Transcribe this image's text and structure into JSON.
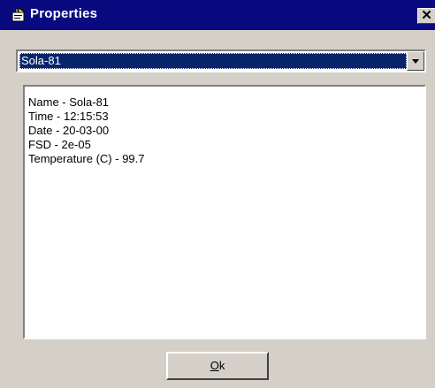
{
  "window": {
    "title": "Properties",
    "close_label": "✕",
    "icons": {
      "title": "properties-icon",
      "close": "close-icon",
      "dropdown": "chevron-down-icon"
    }
  },
  "combo": {
    "selected": "Sola-81"
  },
  "properties": [
    {
      "text": "Name - Sola-81"
    },
    {
      "text": "Time - 12:15:53"
    },
    {
      "text": "Date - 20-03-00"
    },
    {
      "text": "FSD - 2e-05"
    },
    {
      "text": "Temperature (C) - 99.7"
    }
  ],
  "buttons": {
    "ok_mnemonic": "O",
    "ok_rest": "k"
  },
  "colors": {
    "titlebar": "#0a0a80",
    "selection": "#0a246a",
    "face": "#d4d0c8"
  }
}
